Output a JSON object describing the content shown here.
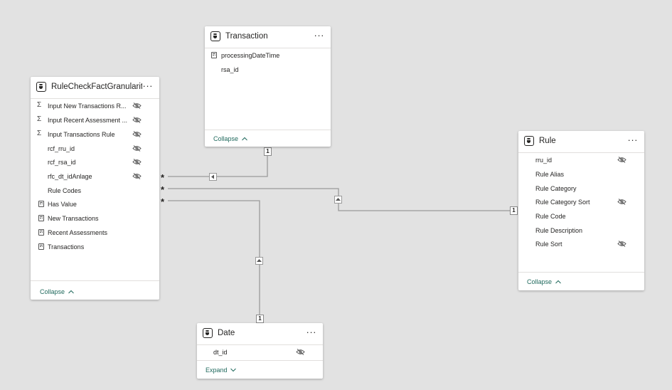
{
  "tables": {
    "rulecheck": {
      "title": "RuleCheckFactGranularit...",
      "fields": [
        {
          "label": "Input New Transactions R...",
          "icon": "sigma-icon",
          "hidden": true
        },
        {
          "label": "Input Recent Assessment ...",
          "icon": "sigma-icon",
          "hidden": true
        },
        {
          "label": "Input Transactions Rule",
          "icon": "sigma-icon",
          "hidden": true
        },
        {
          "label": "rcf_rru_id",
          "icon": "",
          "hidden": true
        },
        {
          "label": "rcf_rsa_id",
          "icon": "",
          "hidden": true
        },
        {
          "label": "rfc_dt_idAnlage",
          "icon": "",
          "hidden": true
        },
        {
          "label": "Rule Codes",
          "icon": "",
          "hidden": false
        },
        {
          "label": "Has Value",
          "icon": "calculator-icon",
          "hidden": false
        },
        {
          "label": "New Transactions",
          "icon": "calculator-icon",
          "hidden": false
        },
        {
          "label": "Recent Assessments",
          "icon": "calculator-icon",
          "hidden": false
        },
        {
          "label": "Transactions",
          "icon": "calculator-icon",
          "hidden": false
        }
      ],
      "footer": "Collapse"
    },
    "transaction": {
      "title": "Transaction",
      "fields": [
        {
          "label": "processingDateTime",
          "icon": "calendar-icon",
          "hidden": false
        },
        {
          "label": "rsa_id",
          "icon": "",
          "hidden": false
        }
      ],
      "footer": "Collapse"
    },
    "rule": {
      "title": "Rule",
      "fields": [
        {
          "label": "rru_id",
          "hidden": true
        },
        {
          "label": "Rule Alias",
          "hidden": false
        },
        {
          "label": "Rule Category",
          "hidden": false
        },
        {
          "label": "Rule Category Sort",
          "hidden": true
        },
        {
          "label": "Rule Code",
          "hidden": false
        },
        {
          "label": "Rule Description",
          "hidden": false
        },
        {
          "label": "Rule Sort",
          "hidden": true
        }
      ],
      "footer": "Collapse"
    },
    "date": {
      "title": "Date",
      "fields": [
        {
          "label": "dt_id",
          "hidden": true
        }
      ],
      "footer": "Expand"
    }
  },
  "relationships": {
    "many_marker": "*",
    "one_marker": "1"
  },
  "icons": {
    "more": "···",
    "chevron_up": "^",
    "chevron_down": "v"
  }
}
